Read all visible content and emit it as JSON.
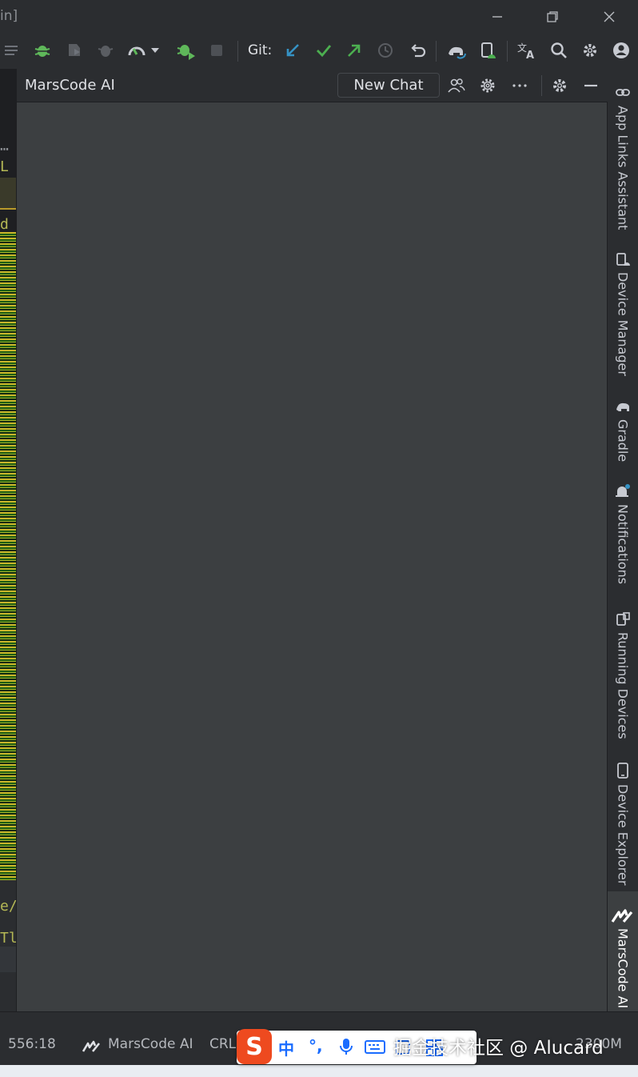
{
  "window": {
    "title_fragment": "in]"
  },
  "toolbar": {
    "git_label": "Git:"
  },
  "editor_strip": {
    "fragments": [
      "L",
      "d",
      "e/",
      "Tl"
    ]
  },
  "panel": {
    "title": "MarsCode AI",
    "new_chat_label": "New Chat"
  },
  "right_strip": {
    "items": [
      {
        "label": "App Links Assistant",
        "icon": "link-icon"
      },
      {
        "label": "Device Manager",
        "icon": "device-manager-icon"
      },
      {
        "label": "Gradle",
        "icon": "gradle-elephant-icon"
      },
      {
        "label": "Notifications",
        "icon": "bell-icon"
      },
      {
        "label": "Running Devices",
        "icon": "running-devices-icon"
      },
      {
        "label": "Device Explorer",
        "icon": "phone-icon"
      },
      {
        "label": "MarsCode AI",
        "icon": "marscode-icon"
      }
    ]
  },
  "statusbar": {
    "position": "556:18",
    "plugin": "MarsCode AI",
    "line_sep": "CRL",
    "memory": "2300M"
  },
  "ime": {
    "logo": "S",
    "mode": "中",
    "punct": "°,"
  },
  "watermark": "掘金技术社区 @ Alucard",
  "colors": {
    "accent_green": "#4caf50",
    "accent_blue": "#3592c4",
    "panel_bg": "#3c3f41",
    "ime_red": "#ee4a1f"
  }
}
